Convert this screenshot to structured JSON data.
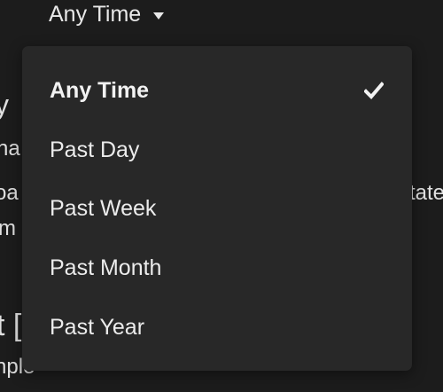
{
  "filter": {
    "selected_label": "Any Time",
    "caret_icon": "caret-down-icon"
  },
  "menu": {
    "items": [
      {
        "label": "Any Time",
        "selected": true,
        "icon": "checkmark-icon"
      },
      {
        "label": "Past Day",
        "selected": false
      },
      {
        "label": "Past Week",
        "selected": false
      },
      {
        "label": "Past Month",
        "selected": false
      },
      {
        "label": "Past Year",
        "selected": false
      }
    ]
  },
  "background": {
    "heading_1": "y",
    "line_1": "na",
    "line_2_left": "oa",
    "line_2_right": "tate",
    "line_3": "m I",
    "heading_2": "t [",
    "line_4": "nple"
  }
}
